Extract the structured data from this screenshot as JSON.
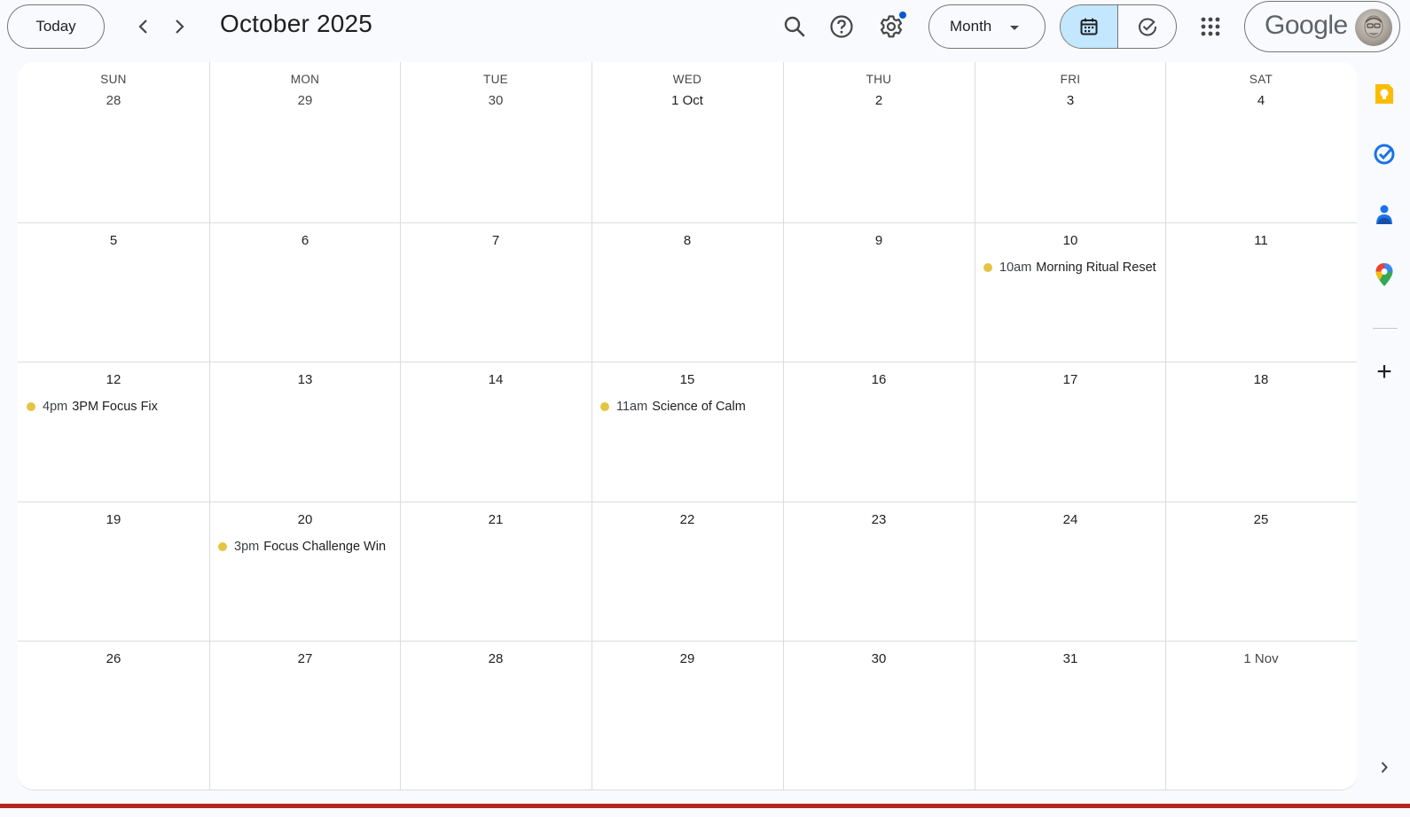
{
  "header": {
    "today_label": "Today",
    "title": "October 2025",
    "view_label": "Month",
    "brand": "Google",
    "colors": {
      "accent": "#0b57d0",
      "active_toggle": "#c2e7ff",
      "event_dot": "#e4c441"
    }
  },
  "calendar": {
    "weekdays": [
      "SUN",
      "MON",
      "TUE",
      "WED",
      "THU",
      "FRI",
      "SAT"
    ],
    "weeks": [
      [
        "28",
        "29",
        "30",
        "1 Oct",
        "2",
        "3",
        "4"
      ],
      [
        "5",
        "6",
        "7",
        "8",
        "9",
        "10",
        "11"
      ],
      [
        "12",
        "13",
        "14",
        "15",
        "16",
        "17",
        "18"
      ],
      [
        "19",
        "20",
        "21",
        "22",
        "23",
        "24",
        "25"
      ],
      [
        "26",
        "27",
        "28",
        "29",
        "30",
        "31",
        "1 Nov"
      ]
    ],
    "events": [
      {
        "week": 1,
        "day": 5,
        "time": "10am",
        "title": "Morning Ritual Reset"
      },
      {
        "week": 2,
        "day": 0,
        "time": "4pm",
        "title": "3PM Focus Fix"
      },
      {
        "week": 2,
        "day": 3,
        "time": "11am",
        "title": "Science of Calm"
      },
      {
        "week": 3,
        "day": 1,
        "time": "3pm",
        "title": "Focus Challenge Win"
      }
    ]
  },
  "side_panel": {
    "icons": [
      "keep-icon",
      "tasks-icon",
      "contacts-icon",
      "maps-icon"
    ],
    "add_label": "+"
  }
}
